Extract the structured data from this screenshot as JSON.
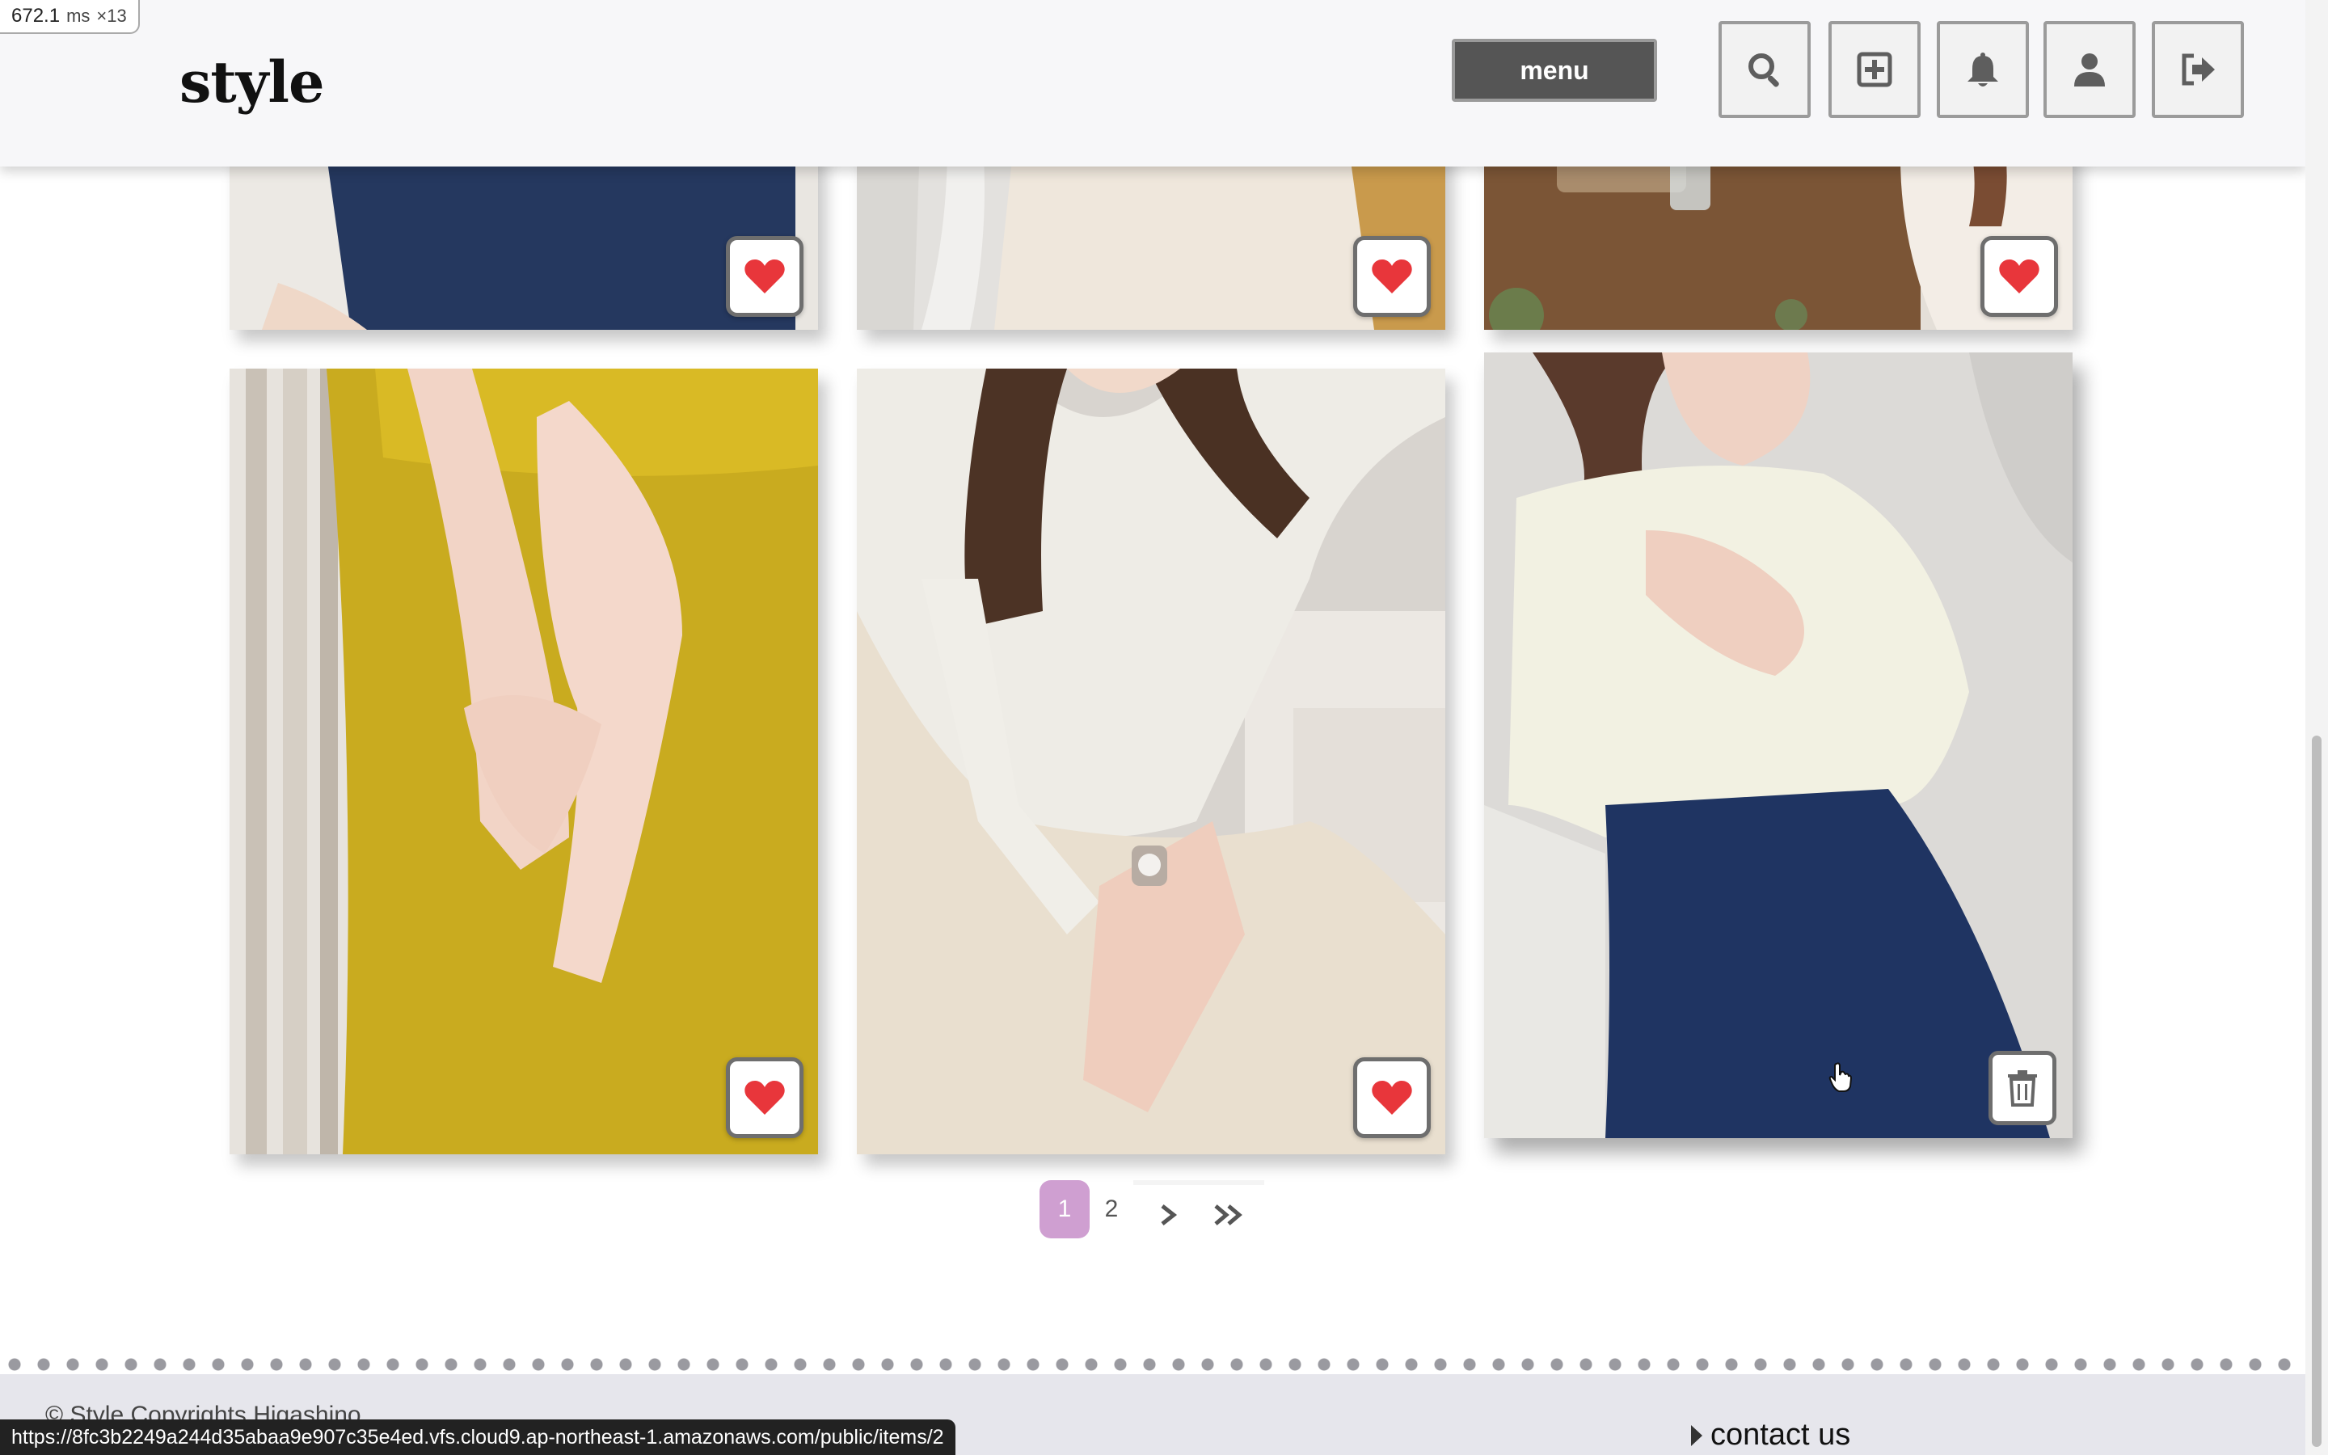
{
  "header": {
    "logo": "style",
    "menu_label": "menu",
    "icons": [
      "search-icon",
      "add-square-icon",
      "bell-icon",
      "user-icon",
      "logout-icon"
    ]
  },
  "gallery": {
    "top_row": [
      {
        "action": "like",
        "icon": "heart-icon"
      },
      {
        "action": "like",
        "icon": "heart-icon"
      },
      {
        "action": "like",
        "icon": "heart-icon"
      }
    ],
    "bottom_row": [
      {
        "action": "like",
        "icon": "heart-icon"
      },
      {
        "action": "like",
        "icon": "heart-icon"
      },
      {
        "action": "delete",
        "icon": "trash-icon"
      }
    ],
    "accent_heart": "#e8363b"
  },
  "pagination": {
    "current": "1",
    "pages": [
      "1",
      "2"
    ],
    "next_icon": "chevron-right-icon",
    "last_icon": "double-chevron-right-icon",
    "active_color": "#cf9fd1"
  },
  "footer": {
    "copyright": "© Style Copyrights Higashino",
    "contact": "contact us"
  },
  "overlay": {
    "perf_value": "672.1",
    "perf_unit": "ms",
    "perf_multiplier": "×13",
    "status_url": "https://8fc3b2249a244d35abaa9e907c35e4ed.vfs.cloud9.ap-northeast-1.amazonaws.com/public/items/2"
  }
}
